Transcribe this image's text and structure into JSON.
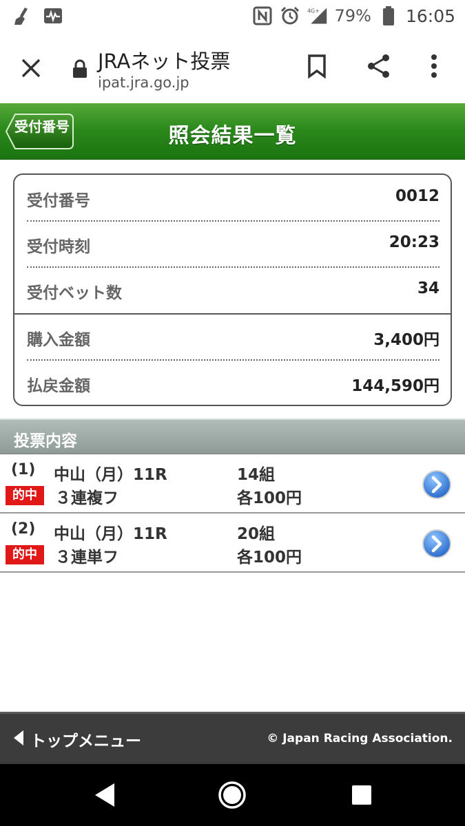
{
  "status_bar": {
    "battery_percent": "79%",
    "network": "4G+",
    "time": "16:05",
    "icons": [
      "broom-icon",
      "pulse-icon",
      "nfc-icon",
      "alarm-icon",
      "signal-icon",
      "battery-icon"
    ]
  },
  "browser": {
    "title": "JRAネット投票",
    "url": "ipat.jra.go.jp"
  },
  "header": {
    "back_label": "受付番号",
    "title": "照会結果一覧",
    "accent_color": "#2c8a1c"
  },
  "summary": {
    "receipt_number": {
      "label": "受付番号",
      "value": "0012"
    },
    "receipt_time": {
      "label": "受付時刻",
      "value": "20:23"
    },
    "bet_count": {
      "label": "受付ベット数",
      "value": "34"
    },
    "purchase_amount": {
      "label": "購入金額",
      "value": "3,400円"
    },
    "payout_amount": {
      "label": "払戻金額",
      "value": "144,590円"
    }
  },
  "section": {
    "title": "投票内容"
  },
  "tickets": [
    {
      "number": "(1)",
      "venue": "中山（月）11R",
      "count": "14組",
      "badge": "的中",
      "bet_type": "３連複フ",
      "unit": "各100円"
    },
    {
      "number": "(2)",
      "venue": "中山（月）11R",
      "count": "20組",
      "badge": "的中",
      "bet_type": "３連単フ",
      "unit": "各100円"
    }
  ],
  "footer": {
    "menu_label": "トップメニュー",
    "copyright": "© Japan Racing Association."
  }
}
